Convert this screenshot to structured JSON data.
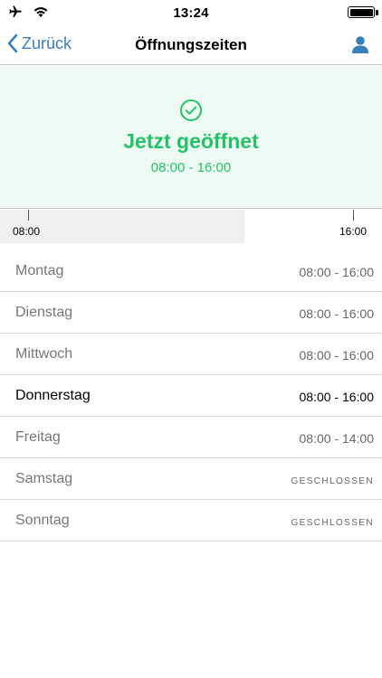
{
  "status_bar": {
    "time": "13:24",
    "icons": [
      "airplane-icon",
      "wifi-icon",
      "battery-icon"
    ]
  },
  "nav": {
    "back_label": "Zurück",
    "title": "Öffnungszeiten",
    "right_icon": "person-icon"
  },
  "open_status": {
    "icon": "check-circle-icon",
    "title": "Jetzt geöffnet",
    "hours": "08:00 - 16:00",
    "color": "#25c267",
    "background": "#eefbf4"
  },
  "timeline": {
    "start_label": "08:00",
    "end_label": "16:00",
    "elapsed_fraction": 0.64
  },
  "days": [
    {
      "name": "Montag",
      "hours": "08:00 - 16:00",
      "closed": false,
      "today": false
    },
    {
      "name": "Dienstag",
      "hours": "08:00 - 16:00",
      "closed": false,
      "today": false
    },
    {
      "name": "Mittwoch",
      "hours": "08:00 - 16:00",
      "closed": false,
      "today": false
    },
    {
      "name": "Donnerstag",
      "hours": "08:00 - 16:00",
      "closed": false,
      "today": true
    },
    {
      "name": "Freitag",
      "hours": "08:00 - 14:00",
      "closed": false,
      "today": false
    },
    {
      "name": "Samstag",
      "hours": "GESCHLOSSEN",
      "closed": true,
      "today": false
    },
    {
      "name": "Sonntag",
      "hours": "GESCHLOSSEN",
      "closed": true,
      "today": false
    }
  ],
  "colors": {
    "accent": "#3a7fbd",
    "open_green": "#25c267"
  }
}
